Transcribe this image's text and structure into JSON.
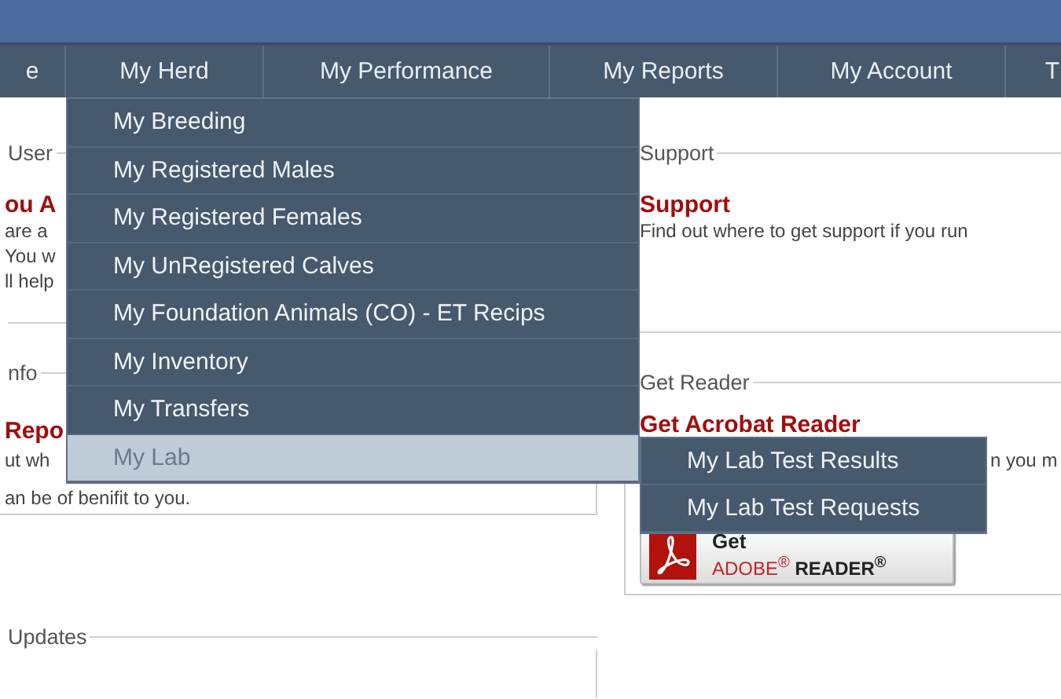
{
  "nav": [
    {
      "label": "e"
    },
    {
      "label": "My Herd"
    },
    {
      "label": "My Performance"
    },
    {
      "label": "My Reports"
    },
    {
      "label": "My Account"
    },
    {
      "label": "T"
    }
  ],
  "dropdown": {
    "items": [
      {
        "label": "My Breeding",
        "selected": false
      },
      {
        "label": "My Registered Males",
        "selected": false
      },
      {
        "label": "My Registered Females",
        "selected": false
      },
      {
        "label": "My UnRegistered Calves",
        "selected": false
      },
      {
        "label": "My Foundation Animals (CO) - ET Recips",
        "selected": false
      },
      {
        "label": "My Inventory",
        "selected": false
      },
      {
        "label": "My Transfers",
        "selected": false
      },
      {
        "label": "My Lab",
        "selected": true
      }
    ]
  },
  "submenu": {
    "items": [
      {
        "label": "My Lab Test Results",
        "selected": false
      },
      {
        "label": "My Lab Test Requests",
        "selected": false
      }
    ]
  },
  "left": {
    "user": {
      "legend": "User",
      "heading": "ou A",
      "lines": [
        "are a",
        "You w",
        "ll help"
      ]
    },
    "info": {
      "legend": "nfo",
      "heading": "Repo",
      "lines": [
        "ut wh",
        "an be of benifit to you."
      ]
    },
    "updates": {
      "legend": "Updates"
    }
  },
  "right": {
    "support": {
      "legend": "Support",
      "heading": "Support",
      "text": "Find out where to get support if you run"
    },
    "reader": {
      "legend": "Get Reader",
      "heading": "Get Acrobat Reader",
      "text": "n you m",
      "badge": {
        "get": "Get",
        "brand": "ADOBE$^{®}$",
        "product": "READER$^{®}$"
      }
    }
  }
}
